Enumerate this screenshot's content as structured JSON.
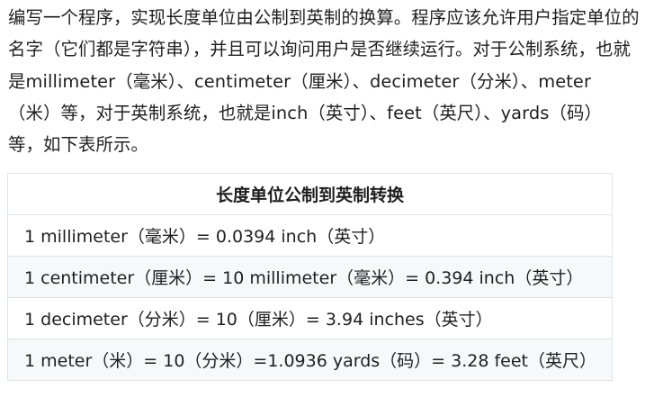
{
  "intro": {
    "lines": [
      "编写一个程序，实现长度单位由公制到英制的换算。程序应该允许用户指定单位的",
      "名字（它们都是字符串），并且可以询问用户是否继续运行。对于公制系统，也就",
      "是millimeter（毫米）、centimeter（厘米）、decimeter（分米）、meter",
      "（米）等，对于英制系统，也就是inch（英寸）、feet（英尺）、yards（码）",
      "等，如下表所示。"
    ]
  },
  "table": {
    "header": "长度单位公制到英制转换",
    "rows": [
      "1 millimeter（毫米）= 0.0394 inch（英寸）",
      "1 centimeter（厘米）= 10 millimeter（毫米）= 0.394 inch（英寸）",
      "1 decimeter（分米）= 10（厘米）= 3.94 inches（英寸）",
      "1 meter（米）= 10（分米）=1.0936 yards（码）= 3.28 feet（英尺）"
    ]
  }
}
